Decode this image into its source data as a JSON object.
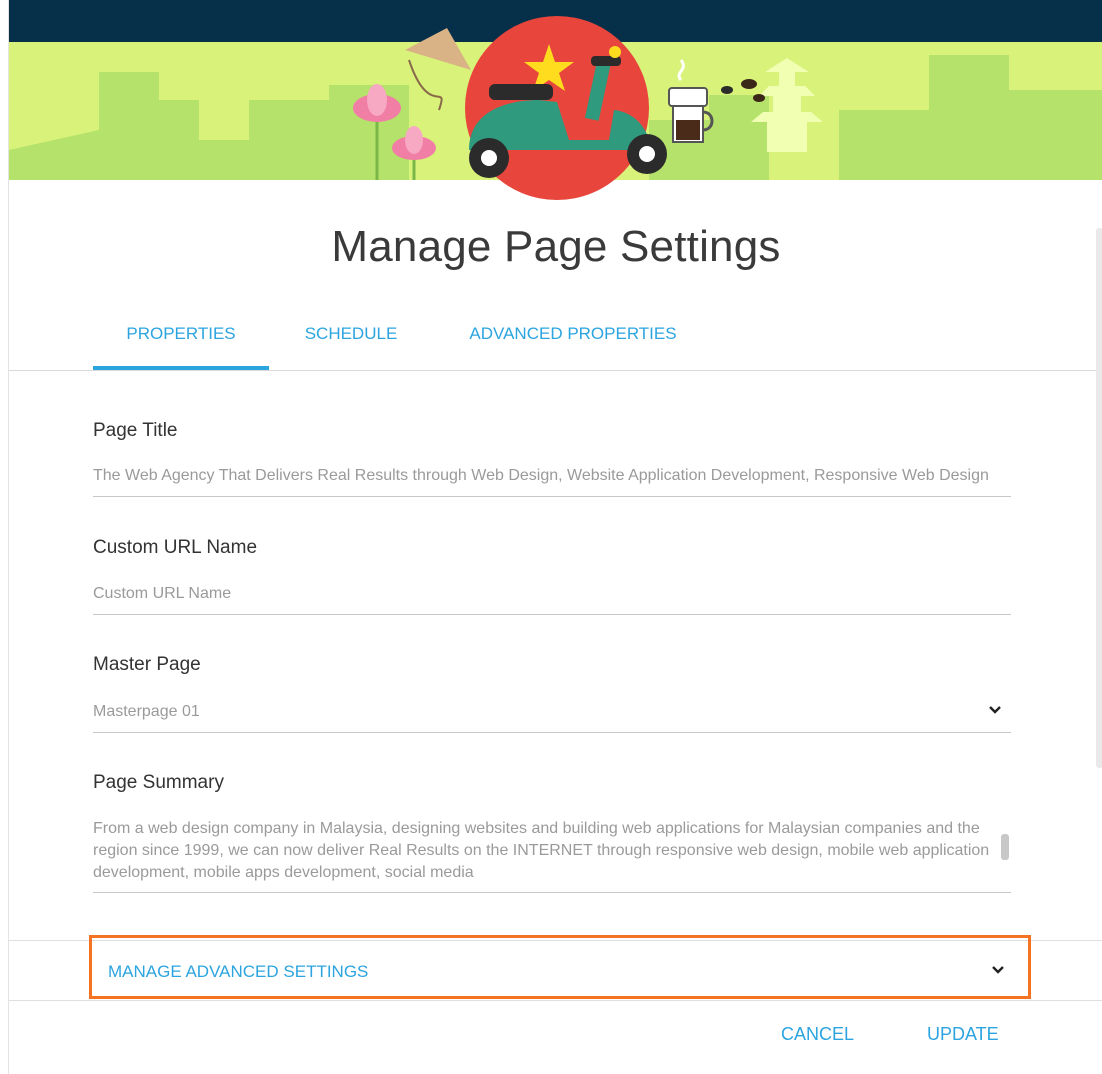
{
  "dialog": {
    "title": "Manage Page Settings",
    "tabs": [
      {
        "label": "PROPERTIES",
        "active": true
      },
      {
        "label": "SCHEDULE",
        "active": false
      },
      {
        "label": "ADVANCED PROPERTIES",
        "active": false
      }
    ]
  },
  "fields": {
    "page_title": {
      "label": "Page Title",
      "value": "The Web Agency That Delivers Real Results through Web Design, Website Application Development, Responsive Web Design"
    },
    "custom_url": {
      "label": "Custom URL Name",
      "placeholder": "Custom URL Name"
    },
    "master_page": {
      "label": "Master Page",
      "selected": "Masterpage 01",
      "icon": "chevron-down-icon"
    },
    "page_summary": {
      "label": "Page Summary",
      "value": "From a web design company in Malaysia, designing websites and building web applications for Malaysian companies and the region since 1999, we can now deliver Real Results on the INTERNET through responsive web design, mobile web application development, mobile apps development, social media"
    }
  },
  "advanced_settings": {
    "label": "MANAGE ADVANCED SETTINGS",
    "icon": "chevron-down-icon",
    "highlight_color": "#f57322"
  },
  "actions": {
    "cancel": "CANCEL",
    "update": "UPDATE"
  },
  "colors": {
    "accent": "#2ba4e0",
    "topbar": "#06304a",
    "banner_green": "#d8f27a",
    "highlight": "#f57322"
  }
}
